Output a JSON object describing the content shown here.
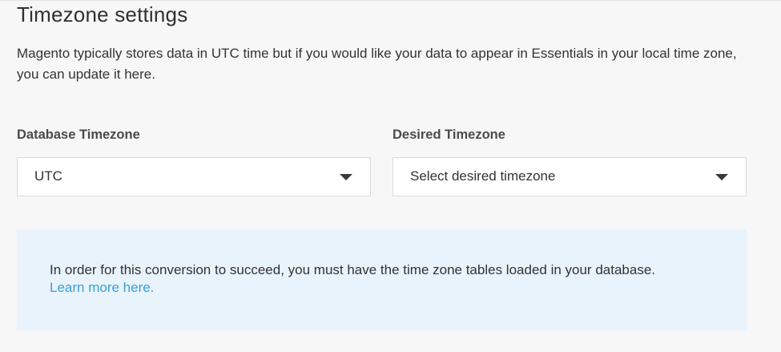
{
  "section": {
    "title": "Timezone settings",
    "description": "Magento typically stores data in UTC time but if you would like your data to appear in Essentials in your local time zone, you can update it here."
  },
  "database_timezone": {
    "label": "Database Timezone",
    "value": "UTC",
    "icon": "chevron-down-icon"
  },
  "desired_timezone": {
    "label": "Desired Timezone",
    "value": "Select desired timezone",
    "icon": "chevron-down-icon"
  },
  "notice": {
    "text": "In order for this conversion to succeed, you must have the time zone tables loaded in your database.",
    "link_text": "Learn more here.",
    "link_color": "#3aa0d8",
    "background_color": "#e9f3fb"
  }
}
